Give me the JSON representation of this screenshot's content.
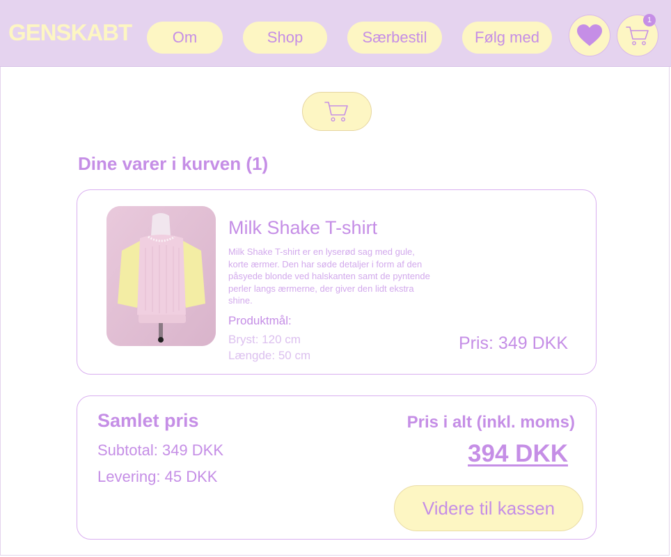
{
  "brand": "GENSKABT",
  "nav": {
    "items": [
      {
        "label": "Om"
      },
      {
        "label": "Shop"
      },
      {
        "label": "Særbestil"
      },
      {
        "label": "Følg med"
      }
    ],
    "favorites_icon": "heart-icon",
    "cart_icon": "cart-icon",
    "cart_count": "1"
  },
  "cart": {
    "heading": "Dine varer i kurven (1)",
    "items": [
      {
        "name": "Milk Shake T-shirt",
        "description": "Milk Shake T-shirt er en lyserød sag med gule, korte ærmer. Den har søde detaljer i form af den påsyede blonde ved halskanten samt de pyntende perler langs ærmerne, der giver den lidt ekstra shine.",
        "dimensions_title": "Produktmål:",
        "chest": "Bryst: 120 cm",
        "length": "Længde: 50 cm",
        "price": "Pris: 349 DKK"
      }
    ]
  },
  "summary": {
    "title": "Samlet pris",
    "subtotal": "Subtotal: 349 DKK",
    "delivery": "Levering: 45 DKK",
    "total_label": "Pris i alt (inkl. moms)",
    "total_value": "394 DKK",
    "checkout_label": "Videre til kassen"
  },
  "colors": {
    "header_bg": "#e5d3ef",
    "accent": "#c58ee6",
    "button_bg": "#fdf6c3"
  }
}
